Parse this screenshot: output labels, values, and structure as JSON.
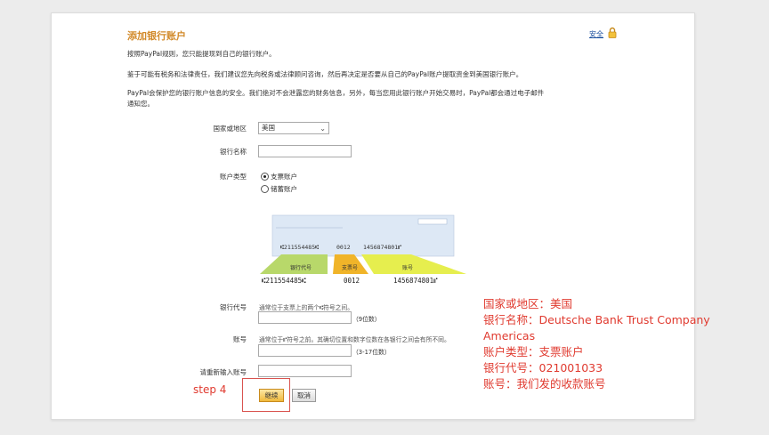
{
  "header": {
    "title": "添加银行账户",
    "security_link": "安全"
  },
  "intro": {
    "p1": "按照PayPal规则，您只能提现到自己的银行账户。",
    "p2": "鉴于可能有税务和法律责任，我们建议您先向税务或法律顾问咨询，然后再决定是否要从自己的PayPal账户提取资金到美国银行账户。",
    "p3_line1": "PayPal会保护您的银行账户信息的安全。我们绝对不会泄露您的财务信息，另外，每当您用此银行账户开始交易时，PayPal都会通过电子邮件",
    "p3_line2": "通知您。"
  },
  "form": {
    "country_label": "国家或地区",
    "country_value": "美国",
    "bank_name_label": "银行名称",
    "bank_name_value": "",
    "account_type_label": "账户类型",
    "account_types": [
      {
        "label": "支票账户",
        "selected": true
      },
      {
        "label": "储蓄账户",
        "selected": false
      }
    ],
    "routing_label": "银行代号",
    "routing_hint": "通常位于支票上的两个⑆符号之间。",
    "routing_digits": "（9位数）",
    "account_label": "账号",
    "account_hint": "通常位于⑈符号之前。其确切位置和数字位数在各银行之间会有所不同。",
    "account_digits": "（3-17位数）",
    "reenter_label": "请重新输入账号",
    "continue_button": "继续",
    "cancel_button": "取消"
  },
  "check_image": {
    "micr_top_routing": "⑆211554485⑆",
    "micr_top_check": "0012",
    "micr_top_account": "1456874801⑈",
    "routing_tag": "银行代号",
    "check_tag": "支票号",
    "account_tag": "账号",
    "micr_bottom_routing": "⑆211554485⑆",
    "micr_bottom_check": "0012",
    "micr_bottom_account": "1456874801⑈",
    "colors": {
      "check_bg": "#dde8f5",
      "routing": "#b8d86a",
      "check": "#f0b429",
      "account": "#e6ee4e"
    }
  },
  "annotations": {
    "step": "step 4",
    "notes": [
      "国家或地区：美国",
      "银行名称：Deutsche Bank Trust Company",
      "Americas",
      "账户类型：支票账户",
      "银行代号：021001033",
      "账号：我们发的收款账号"
    ]
  }
}
